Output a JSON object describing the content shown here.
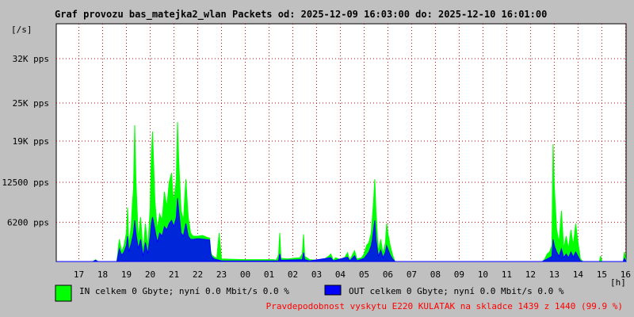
{
  "colors": {
    "background": "#c0c0c0",
    "plot_background": "#ffffff",
    "in_color": "#00ff00",
    "out_color": "#0000ff",
    "grid_color": "#cc0000",
    "note_color": "#ff0000"
  },
  "chart_data": {
    "type": "area",
    "title": "Graf provozu bas_matejka2_wlan Packets od: 2025-12-09 16:03:00 do: 2025-12-10 16:01:00",
    "ylabel": "[/s]",
    "xlabel": "[h]",
    "ylim": [
      0,
      37500
    ],
    "yticks": [
      6200,
      12500,
      19000,
      25000,
      32000
    ],
    "ytick_labels": [
      "6200 pps",
      "12500 pps",
      "19K pps",
      "25K pps",
      "32K pps"
    ],
    "xlim": [
      16.05,
      40.02
    ],
    "xticks": [
      17,
      18,
      19,
      20,
      21,
      22,
      23,
      24,
      25,
      26,
      27,
      28,
      29,
      30,
      31,
      32,
      33,
      34,
      35,
      36,
      37,
      38,
      39,
      40
    ],
    "xtick_labels": [
      "17",
      "18",
      "19",
      "20",
      "21",
      "22",
      "23",
      "00",
      "01",
      "02",
      "03",
      "04",
      "05",
      "06",
      "07",
      "08",
      "09",
      "10",
      "11",
      "12",
      "13",
      "14",
      "15",
      "16"
    ],
    "grid": true,
    "series": [
      {
        "name": "IN",
        "points": [
          [
            16.05,
            0
          ],
          [
            17.6,
            0
          ],
          [
            17.7,
            300
          ],
          [
            17.8,
            0
          ],
          [
            18.6,
            0
          ],
          [
            18.7,
            3500
          ],
          [
            18.8,
            1500
          ],
          [
            18.9,
            2500
          ],
          [
            19.0,
            4500
          ],
          [
            19.05,
            8500
          ],
          [
            19.1,
            2500
          ],
          [
            19.2,
            5500
          ],
          [
            19.25,
            9000
          ],
          [
            19.3,
            11500
          ],
          [
            19.35,
            21500
          ],
          [
            19.4,
            13000
          ],
          [
            19.5,
            3500
          ],
          [
            19.6,
            7000
          ],
          [
            19.7,
            1500
          ],
          [
            19.8,
            6000
          ],
          [
            19.9,
            2000
          ],
          [
            20.0,
            8500
          ],
          [
            20.05,
            17000
          ],
          [
            20.1,
            20500
          ],
          [
            20.2,
            9500
          ],
          [
            20.3,
            5000
          ],
          [
            20.4,
            7500
          ],
          [
            20.5,
            6500
          ],
          [
            20.6,
            11000
          ],
          [
            20.7,
            8500
          ],
          [
            20.8,
            12500
          ],
          [
            20.9,
            14000
          ],
          [
            20.95,
            11000
          ],
          [
            21.0,
            9500
          ],
          [
            21.1,
            13000
          ],
          [
            21.15,
            22000
          ],
          [
            21.2,
            16000
          ],
          [
            21.3,
            8000
          ],
          [
            21.4,
            6500
          ],
          [
            21.5,
            13000
          ],
          [
            21.6,
            7000
          ],
          [
            21.7,
            4500
          ],
          [
            21.8,
            4000
          ],
          [
            21.9,
            4000
          ],
          [
            22.0,
            4000
          ],
          [
            22.2,
            4100
          ],
          [
            22.4,
            3800
          ],
          [
            22.5,
            3700
          ],
          [
            22.55,
            1500
          ],
          [
            22.6,
            1000
          ],
          [
            22.7,
            700
          ],
          [
            22.8,
            500
          ],
          [
            22.9,
            4500
          ],
          [
            23.0,
            400
          ],
          [
            23.5,
            350
          ],
          [
            24.0,
            300
          ],
          [
            24.5,
            300
          ],
          [
            25.0,
            300
          ],
          [
            25.2,
            300
          ],
          [
            25.3,
            200
          ],
          [
            25.4,
            1000
          ],
          [
            25.45,
            4500
          ],
          [
            25.5,
            500
          ],
          [
            25.8,
            400
          ],
          [
            26.0,
            500
          ],
          [
            26.3,
            600
          ],
          [
            26.4,
            1200
          ],
          [
            26.45,
            4300
          ],
          [
            26.5,
            800
          ],
          [
            26.7,
            300
          ],
          [
            27.0,
            200
          ],
          [
            27.3,
            300
          ],
          [
            27.5,
            800
          ],
          [
            27.6,
            1200
          ],
          [
            27.7,
            200
          ],
          [
            27.8,
            600
          ],
          [
            28.0,
            300
          ],
          [
            28.2,
            700
          ],
          [
            28.3,
            1400
          ],
          [
            28.4,
            200
          ],
          [
            28.6,
            1700
          ],
          [
            28.7,
            400
          ],
          [
            28.9,
            600
          ],
          [
            29.0,
            1200
          ],
          [
            29.1,
            2500
          ],
          [
            29.2,
            3000
          ],
          [
            29.3,
            4500
          ],
          [
            29.35,
            7000
          ],
          [
            29.4,
            9500
          ],
          [
            29.45,
            13000
          ],
          [
            29.5,
            8000
          ],
          [
            29.6,
            1500
          ],
          [
            29.7,
            3500
          ],
          [
            29.8,
            1200
          ],
          [
            29.9,
            3000
          ],
          [
            29.95,
            6000
          ],
          [
            30.0,
            4500
          ],
          [
            30.1,
            2500
          ],
          [
            30.2,
            1000
          ],
          [
            30.3,
            0
          ],
          [
            36.5,
            0
          ],
          [
            36.6,
            400
          ],
          [
            36.7,
            1200
          ],
          [
            36.8,
            1500
          ],
          [
            36.9,
            2500
          ],
          [
            36.95,
            18500
          ],
          [
            37.0,
            12000
          ],
          [
            37.1,
            5000
          ],
          [
            37.2,
            3000
          ],
          [
            37.3,
            8000
          ],
          [
            37.4,
            2000
          ],
          [
            37.5,
            4000
          ],
          [
            37.6,
            2000
          ],
          [
            37.7,
            5000
          ],
          [
            37.8,
            2500
          ],
          [
            37.9,
            6000
          ],
          [
            38.0,
            3000
          ],
          [
            38.1,
            400
          ],
          [
            38.2,
            0
          ],
          [
            38.9,
            0
          ],
          [
            38.95,
            900
          ],
          [
            39.0,
            0
          ],
          [
            39.9,
            0
          ],
          [
            39.95,
            1500
          ],
          [
            40.0,
            600
          ],
          [
            40.02,
            0
          ]
        ]
      },
      {
        "name": "OUT",
        "points": [
          [
            16.05,
            0
          ],
          [
            17.6,
            0
          ],
          [
            17.7,
            200
          ],
          [
            17.8,
            0
          ],
          [
            18.6,
            0
          ],
          [
            18.7,
            2000
          ],
          [
            18.8,
            1000
          ],
          [
            18.9,
            1500
          ],
          [
            19.0,
            2500
          ],
          [
            19.05,
            4000
          ],
          [
            19.1,
            1500
          ],
          [
            19.2,
            2800
          ],
          [
            19.3,
            4500
          ],
          [
            19.35,
            6500
          ],
          [
            19.4,
            4500
          ],
          [
            19.5,
            2000
          ],
          [
            19.6,
            3500
          ],
          [
            19.7,
            800
          ],
          [
            19.8,
            3000
          ],
          [
            19.9,
            1200
          ],
          [
            20.0,
            4000
          ],
          [
            20.05,
            6000
          ],
          [
            20.1,
            7000
          ],
          [
            20.2,
            5000
          ],
          [
            20.3,
            3000
          ],
          [
            20.4,
            4500
          ],
          [
            20.5,
            4000
          ],
          [
            20.6,
            5500
          ],
          [
            20.7,
            5000
          ],
          [
            20.8,
            6000
          ],
          [
            20.9,
            6500
          ],
          [
            21.0,
            5500
          ],
          [
            21.1,
            7000
          ],
          [
            21.15,
            10000
          ],
          [
            21.2,
            8000
          ],
          [
            21.3,
            4500
          ],
          [
            21.4,
            4000
          ],
          [
            21.5,
            6000
          ],
          [
            21.6,
            4000
          ],
          [
            21.7,
            3500
          ],
          [
            21.8,
            3500
          ],
          [
            22.0,
            3600
          ],
          [
            22.3,
            3500
          ],
          [
            22.5,
            3400
          ],
          [
            22.55,
            1200
          ],
          [
            22.6,
            700
          ],
          [
            22.7,
            400
          ],
          [
            22.8,
            300
          ],
          [
            22.9,
            200
          ],
          [
            23.0,
            100
          ],
          [
            25.4,
            100
          ],
          [
            25.45,
            1200
          ],
          [
            25.5,
            200
          ],
          [
            26.4,
            300
          ],
          [
            26.45,
            1400
          ],
          [
            26.5,
            300
          ],
          [
            26.7,
            100
          ],
          [
            27.6,
            600
          ],
          [
            27.7,
            100
          ],
          [
            28.3,
            700
          ],
          [
            28.4,
            100
          ],
          [
            28.6,
            900
          ],
          [
            28.7,
            100
          ],
          [
            29.0,
            500
          ],
          [
            29.1,
            1000
          ],
          [
            29.2,
            1500
          ],
          [
            29.3,
            2500
          ],
          [
            29.35,
            3500
          ],
          [
            29.4,
            5000
          ],
          [
            29.45,
            6500
          ],
          [
            29.5,
            3500
          ],
          [
            29.6,
            800
          ],
          [
            29.7,
            1800
          ],
          [
            29.8,
            600
          ],
          [
            29.9,
            1500
          ],
          [
            29.95,
            2500
          ],
          [
            30.0,
            2000
          ],
          [
            30.1,
            1000
          ],
          [
            30.2,
            400
          ],
          [
            30.3,
            0
          ],
          [
            36.5,
            0
          ],
          [
            36.7,
            400
          ],
          [
            36.8,
            600
          ],
          [
            36.9,
            800
          ],
          [
            36.95,
            3500
          ],
          [
            37.0,
            2500
          ],
          [
            37.1,
            1500
          ],
          [
            37.2,
            800
          ],
          [
            37.3,
            2000
          ],
          [
            37.4,
            600
          ],
          [
            37.5,
            1200
          ],
          [
            37.6,
            600
          ],
          [
            37.7,
            1500
          ],
          [
            37.8,
            700
          ],
          [
            37.9,
            1500
          ],
          [
            38.0,
            800
          ],
          [
            38.1,
            100
          ],
          [
            38.2,
            0
          ],
          [
            39.9,
            0
          ],
          [
            39.95,
            500
          ],
          [
            40.0,
            200
          ],
          [
            40.02,
            0
          ]
        ]
      }
    ]
  },
  "legend": {
    "in_text": "IN celkem 0 Gbyte; nyní   0.0 Mbit/s 0.0 %",
    "out_text": "OUT celkem 0 Gbyte; nyní   0.0 Mbit/s 0.0 %"
  },
  "note": "Pravdepodobnost vyskytu E220 KULATAK na skladce 1439 z 1440 (99.9 %)"
}
